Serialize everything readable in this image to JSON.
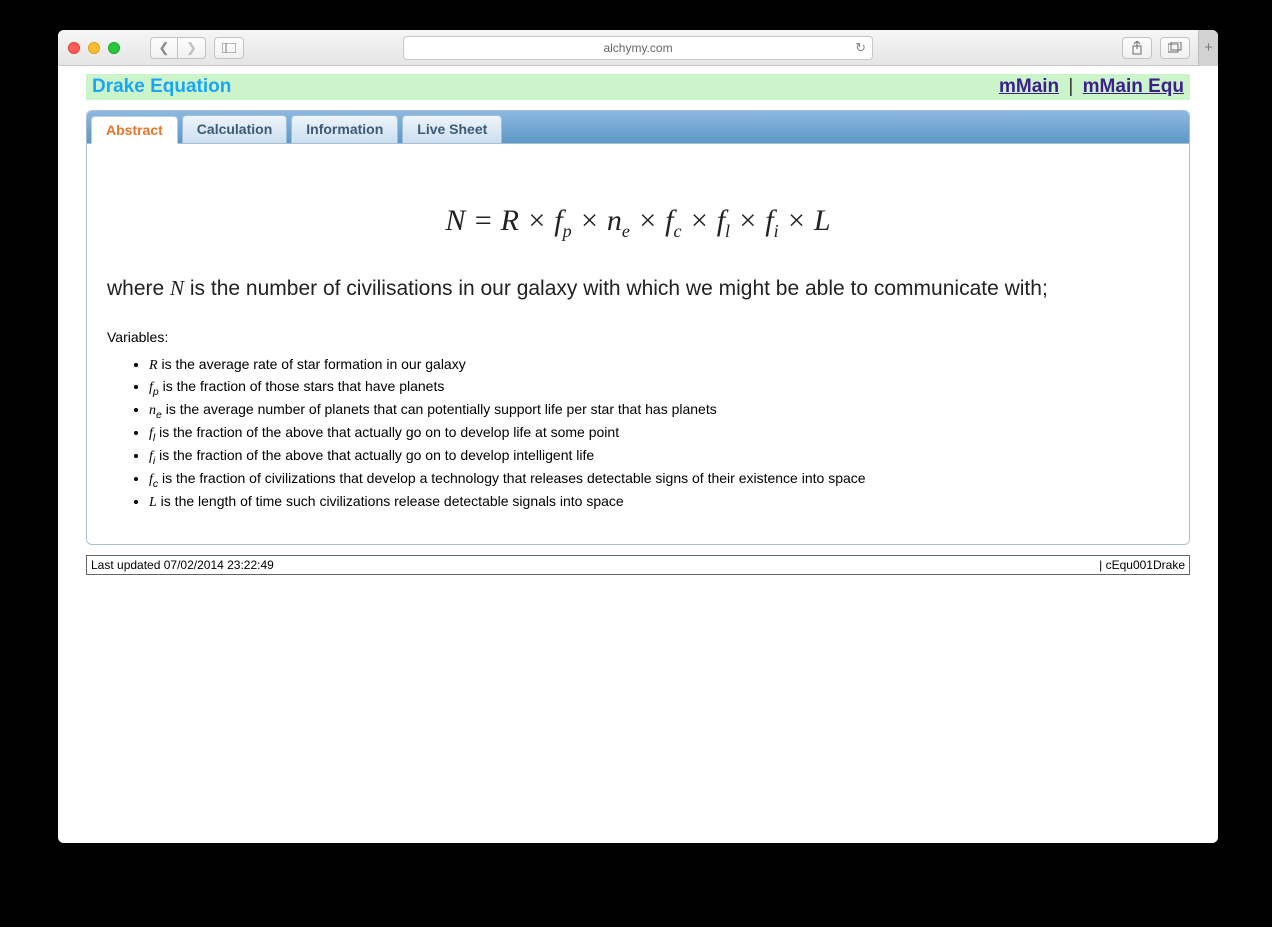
{
  "browser": {
    "url": "alchymy.com"
  },
  "header": {
    "title": "Drake Equation",
    "link1": "mMain",
    "link2": "mMain Equ",
    "separator": " | "
  },
  "tabs": [
    {
      "label": "Abstract",
      "active": true
    },
    {
      "label": "Calculation",
      "active": false
    },
    {
      "label": "Information",
      "active": false
    },
    {
      "label": "Live Sheet",
      "active": false
    }
  ],
  "equation": {
    "lhs": "N",
    "rhs_terms": [
      "R",
      "f_p",
      "n_e",
      "f_c",
      "f_l",
      "f_i",
      "L"
    ]
  },
  "where": {
    "prefix": "where ",
    "var": "N",
    "rest": " is the number of civilisations in our galaxy with which we might be able to communicate with;"
  },
  "variables_label": "Variables:",
  "variables": [
    {
      "sym": "R",
      "sub": "",
      "desc": " is the average rate of star formation in our galaxy"
    },
    {
      "sym": "f",
      "sub": "p",
      "desc": " is the fraction of those stars that have planets"
    },
    {
      "sym": "n",
      "sub": "e",
      "desc": " is the average number of planets that can potentially support life per star that has planets"
    },
    {
      "sym": "f",
      "sub": "l",
      "desc": " is the fraction of the above that actually go on to develop life at some point"
    },
    {
      "sym": "f",
      "sub": "i",
      "desc": " is the fraction of the above that actually go on to develop intelligent life"
    },
    {
      "sym": "f",
      "sub": "c",
      "desc": " is the fraction of civilizations that develop a technology that releases detectable signs of their existence into space"
    },
    {
      "sym": "L",
      "sub": "",
      "desc": " is the length of time such civilizations release detectable signals into space"
    }
  ],
  "footer": {
    "left": "Last updated 07/02/2014 23:22:49",
    "right": "| cEqu001Drake"
  }
}
